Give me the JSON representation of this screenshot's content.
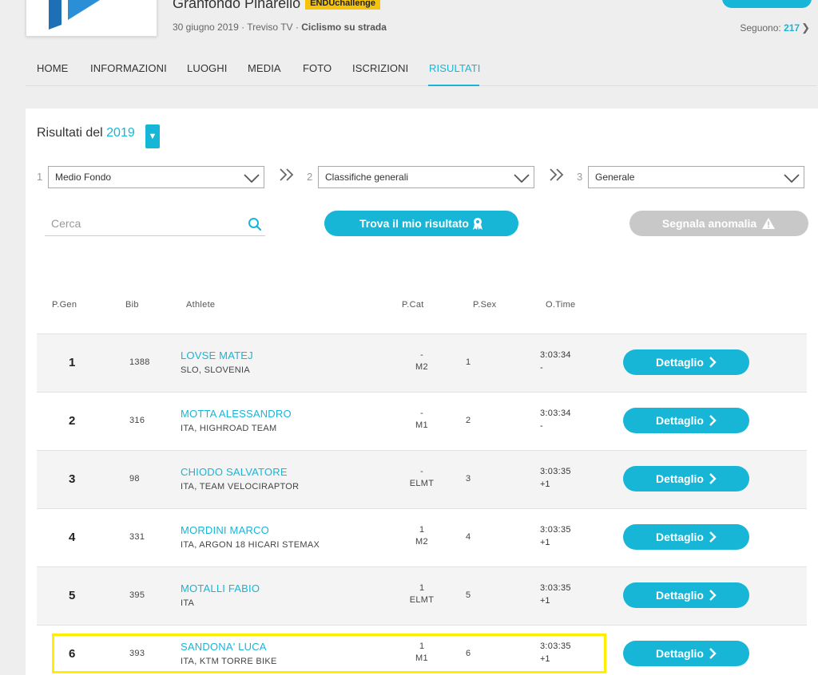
{
  "event": {
    "title": "Granfondo Pinarello",
    "badge": "ENDUchallenge",
    "date_place": "30 giugno 2019 · Treviso TV · ",
    "discipline": "Ciclismo su strada",
    "follow_label": "Seguono: ",
    "follow_count": "217"
  },
  "nav": {
    "home": "HOME",
    "info": "INFORMAZIONI",
    "places": "LUOGHI",
    "media": "MEDIA",
    "photos": "FOTO",
    "signups": "ISCRIZIONI",
    "results": "RISULTATI"
  },
  "results": {
    "label": "Risultati del ",
    "year": "2019",
    "step1_num": "1",
    "step1_value": "Medio Fondo",
    "step2_num": "2",
    "step2_value": "Classifiche generali",
    "step3_num": "3",
    "step3_value": "Generale",
    "search_placeholder": "Cerca",
    "find_label": "Trova il mio risultato",
    "report_label": "Segnala anomalia"
  },
  "table": {
    "headers": {
      "pgen": "P.Gen",
      "bib": "Bib",
      "athlete": "Athlete",
      "pcat": "P.Cat",
      "psex": "P.Sex",
      "otime": "O.Time"
    },
    "detail_label": "Dettaglio",
    "rows": [
      {
        "pos": "1",
        "bib": "1388",
        "name": "LOVSE MATEJ",
        "team": "SLO, SLOVENIA",
        "pcat": "-",
        "cat": "M2",
        "psex": "1",
        "time": "3:03:34",
        "gap": "-"
      },
      {
        "pos": "2",
        "bib": "316",
        "name": "MOTTA ALESSANDRO",
        "team": "ITA, HIGHROAD TEAM",
        "pcat": "-",
        "cat": "M1",
        "psex": "2",
        "time": "3:03:34",
        "gap": "-"
      },
      {
        "pos": "3",
        "bib": "98",
        "name": "CHIODO SALVATORE",
        "team": "ITA, TEAM VELOCIRAPTOR",
        "pcat": "-",
        "cat": "ELMT",
        "psex": "3",
        "time": "3:03:35",
        "gap": "+1"
      },
      {
        "pos": "4",
        "bib": "331",
        "name": "MORDINI MARCO",
        "team": "ITA, ARGON 18 HICARI STEMAX",
        "pcat": "1",
        "cat": "M2",
        "psex": "4",
        "time": "3:03:35",
        "gap": "+1"
      },
      {
        "pos": "5",
        "bib": "395",
        "name": "MOTALLI FABIO",
        "team": "ITA",
        "pcat": "1",
        "cat": "ELMT",
        "psex": "5",
        "time": "3:03:35",
        "gap": "+1"
      },
      {
        "pos": "6",
        "bib": "393",
        "name": "SANDONA' LUCA",
        "team": "ITA, KTM TORRE BIKE",
        "pcat": "1",
        "cat": "M1",
        "psex": "6",
        "time": "3:03:35",
        "gap": "+1"
      }
    ]
  },
  "colors": {
    "accent": "#17b6d6",
    "badge": "#f5c30b",
    "highlight": "#ffee00",
    "disabled": "#c8c8c8"
  }
}
